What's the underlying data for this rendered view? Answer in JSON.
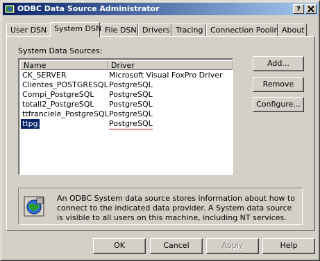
{
  "window": {
    "title": "ODBC Data Source Administrator",
    "help_btn": "?",
    "close_btn": "X"
  },
  "tabs": [
    {
      "label": "User DSN"
    },
    {
      "label": "System DSN"
    },
    {
      "label": "File DSN"
    },
    {
      "label": "Drivers"
    },
    {
      "label": "Tracing"
    },
    {
      "label": "Connection Pooling"
    },
    {
      "label": "About"
    }
  ],
  "active_tab": "System DSN",
  "panel": {
    "list_label": "System Data Sources:",
    "columns": [
      "Name",
      "Driver"
    ],
    "rows": [
      {
        "name": "CK_SERVER",
        "driver": "Microsoft Visual FoxPro Driver"
      },
      {
        "name": "Clientes_POSTGRESQL",
        "driver": "PostgreSQL"
      },
      {
        "name": "Compi_PostgreSQL",
        "driver": "PostgreSQL"
      },
      {
        "name": "totall2_PostgreSQL",
        "driver": "PostgreSQL"
      },
      {
        "name": "ttfranciele_PostgreSQL",
        "driver": "PostgreSQL"
      },
      {
        "name": "ttpg",
        "driver": "PostgreSQL",
        "selected": true
      }
    ],
    "buttons": {
      "add": "Add...",
      "remove": "Remove",
      "configure": "Configure..."
    },
    "info_text": "An ODBC System data source stores information about how to connect to the indicated data provider.  A System data source is visible to all users on this machine, including NT services."
  },
  "footer": {
    "ok": "OK",
    "cancel": "Cancel",
    "apply": "Apply",
    "help": "Help"
  },
  "colors": {
    "titlebar_start": "#0a246a",
    "titlebar_end": "#a6caf0",
    "selection": "#0a246a",
    "face": "#d4d0c8"
  },
  "icons": {
    "app": "odbc-app-icon",
    "info": "globe-database-icon"
  }
}
